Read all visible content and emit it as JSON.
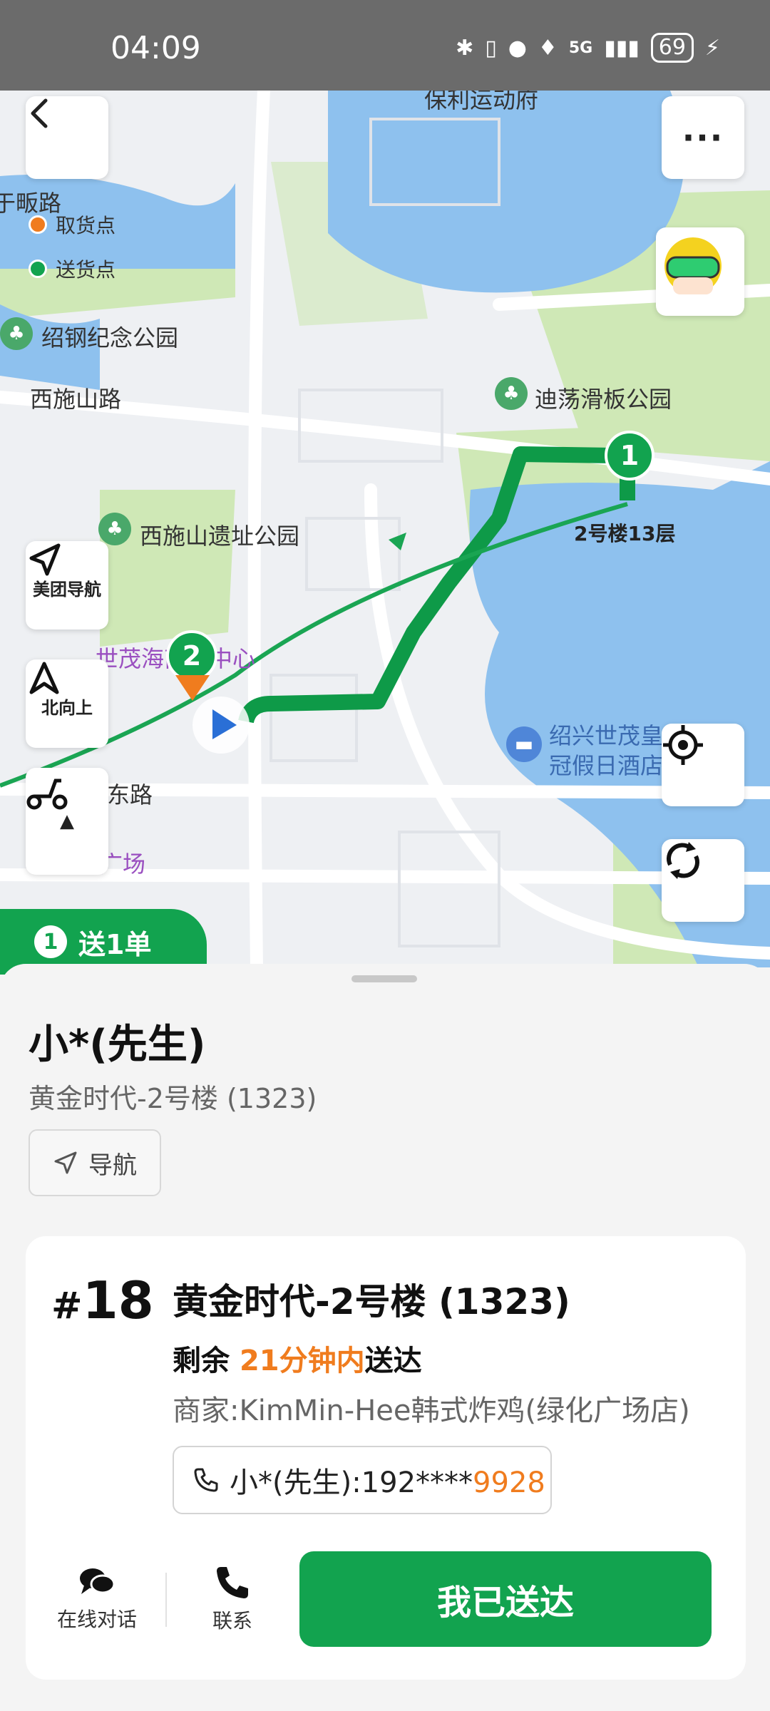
{
  "status_bar": {
    "time": "04:09",
    "signal": "5G",
    "battery": "69"
  },
  "map": {
    "labels": {
      "road_top": "保利运动府",
      "road_left": "于畈路",
      "park1": "绍钢纪念公园",
      "road_xishi": "西施山路",
      "skate_park": "迪荡滑板公园",
      "xishi_park": "西施山遗址公园",
      "building": "2号楼13层",
      "mall": "世茂海商业中心",
      "hotel_line1": "绍兴世茂皇",
      "hotel_line2": "冠假日酒店",
      "road_bottom": "东路",
      "plaza": "广场"
    },
    "legend": {
      "pickup": "取货点",
      "delivery": "送货点"
    },
    "buttons": {
      "meituan_nav": "美团导航",
      "north_up": "北向上"
    },
    "markers": {
      "delivery_no": "1",
      "pickup_no": "2"
    }
  },
  "order_tab": {
    "number": "1",
    "label": "送1单"
  },
  "customer": {
    "name": "小*(先生)",
    "address": "黄金时代-2号楼 (1323)",
    "nav_label": "导航"
  },
  "order_card": {
    "hash": "#",
    "number": "18",
    "address": "黄金时代-2号楼 (1323)",
    "time_prefix": "剩余 ",
    "time_value": "21分钟内",
    "time_suffix": "送达",
    "merchant": "商家:KimMin-Hee韩式炸鸡(绿化广场店)",
    "phone_prefix": "小*(先生):192****",
    "phone_tail": "9928",
    "chat_label": "在线对话",
    "call_label": "联系",
    "delivered_label": "我已送达"
  },
  "colors": {
    "brand_green": "#12a34f",
    "accent_orange": "#f07c1e",
    "water": "#8ec1ee",
    "park": "#cfe8b6"
  }
}
